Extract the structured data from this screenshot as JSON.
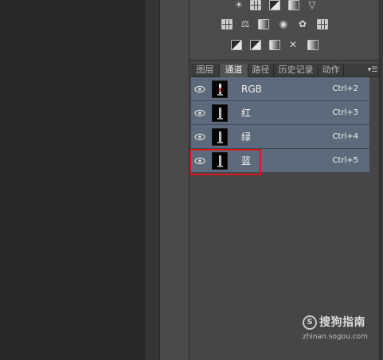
{
  "panel_tabs": [
    {
      "label": "图层"
    },
    {
      "label": "通道"
    },
    {
      "label": "路径"
    },
    {
      "label": "历史记录"
    },
    {
      "label": "动作"
    }
  ],
  "active_tab": "通道",
  "panel_menu_icon": "panel-menu-icon",
  "adjustment_icons": [
    "brightness-icon",
    "levels-icon",
    "curves-icon",
    "exposure-icon",
    "vibrance-icon",
    "hue-saturation-icon",
    "color-balance-icon",
    "black-white-icon",
    "photo-filter-icon",
    "channel-mixer-icon",
    "color-lookup-icon",
    "invert-icon",
    "posterize-icon",
    "threshold-icon",
    "selective-color-icon",
    "gradient-map-icon"
  ],
  "channels": [
    {
      "name": "RGB",
      "shortcut": "Ctrl+2",
      "visible": true,
      "thumb": "rgb"
    },
    {
      "name": "红",
      "shortcut": "Ctrl+3",
      "visible": true,
      "thumb": "gray"
    },
    {
      "name": "绿",
      "shortcut": "Ctrl+4",
      "visible": true,
      "thumb": "gray"
    },
    {
      "name": "蓝",
      "shortcut": "Ctrl+5",
      "visible": true,
      "thumb": "gray"
    }
  ],
  "highlight_color": "#d8161e",
  "watermark": {
    "title": "搜狗指南",
    "url": "zhinan.sogou.com",
    "logo_glyph": "S"
  }
}
